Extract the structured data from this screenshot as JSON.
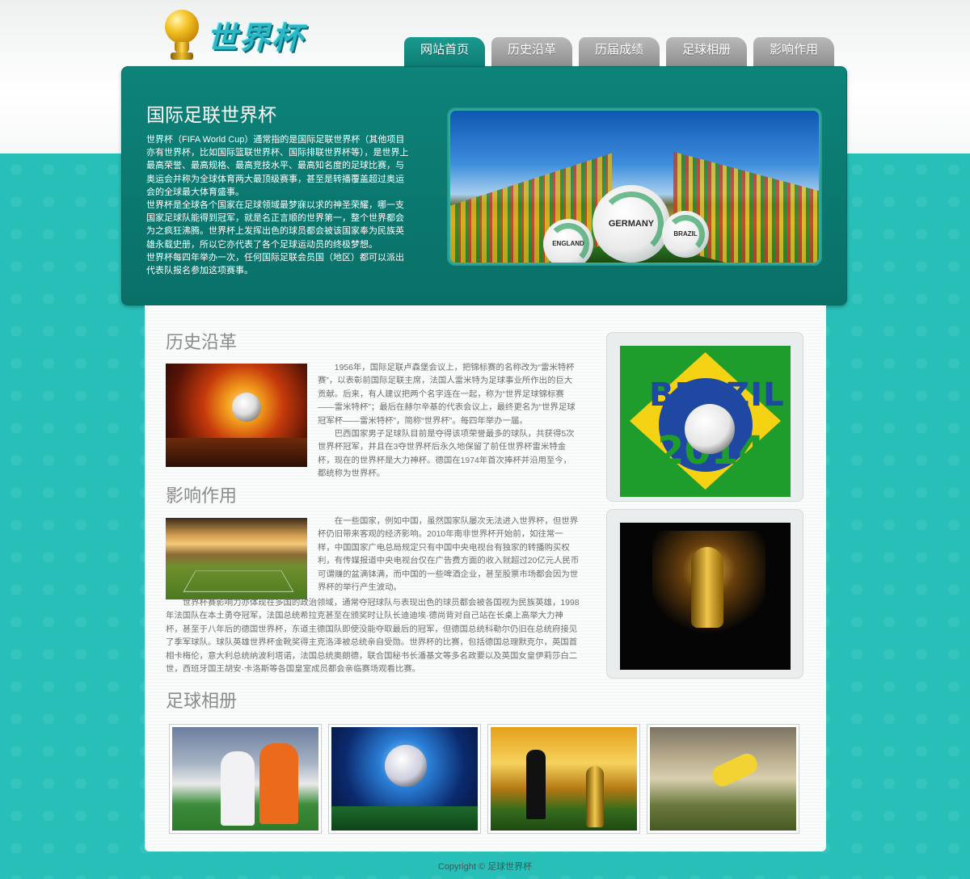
{
  "logo": {
    "text": "世界杯"
  },
  "nav": {
    "tabs": [
      {
        "label": "网站首页",
        "active": true
      },
      {
        "label": "历史沿革",
        "active": false
      },
      {
        "label": "历届成绩",
        "active": false
      },
      {
        "label": "足球相册",
        "active": false
      },
      {
        "label": "影响作用",
        "active": false
      }
    ]
  },
  "hero": {
    "title": "国际足联世界杯",
    "paragraphs": [
      "世界杯（FIFA World Cup）通常指的是国际足联世界杯（其他项目亦有世界杯，比如国际篮联世界杯、国际排联世界杯等），是世界上最高荣誉、最高规格、最高竞技水平、最高知名度的足球比赛，与奥运会并称为全球体育两大最顶级赛事，甚至是转播覆盖超过奥运会的全球最大体育盛事。",
      "世界杯是全球各个国家在足球领域最梦寐以求的神圣荣耀，哪一支国家足球队能得到冠军，就是名正言顺的世界第一，整个世界都会为之疯狂沸腾。世界杯上发挥出色的球员都会被该国家奉为民族英雄永载史册，所以它亦代表了各个足球运动员的终极梦想。",
      "世界杯每四年举办一次，任何国际足联会员国（地区）都可以派出代表队报名参加这项赛事。"
    ],
    "image_balls": [
      "GERMANY",
      "ENGLAND",
      "BRAZIL"
    ]
  },
  "history": {
    "title": "历史沿革",
    "paragraphs": [
      "1956年，国际足联卢森堡会议上，把锦标赛的名称改为“雷米特杯赛”，以表彰前国际足联主席，法国人雷米特为足球事业所作出的巨大贡献。后来，有人建议把两个名字连在一起，称为“世界足球锦标赛——雷米特杯”；最后在赫尔辛基的代表会议上，最终更名为“世界足球冠军杯——雷米特杯”，简称“世界杯”。每四年举办一届。",
      "巴西国家男子足球队目前是夺得该项荣誉最多的球队，共获得5次世界杯冠军，并且在3夺世界杯后永久地保留了前任世界杯雷米特金杯，现在的世界杯是大力神杯。德国在1974年首次捧杯并沿用至今，都统称为世界杯。"
    ]
  },
  "influence": {
    "title": "影响作用",
    "paragraphs": [
      "在一些国家，例如中国，虽然国家队屡次无法进入世界杯，但世界杯仍旧带来客观的经济影响。2010年南非世界杯开始前，如往常一样，中国国家广电总局规定只有中国中央电视台有独家的转播购买权利，有传媒报道中央电视台仅在广告费方面的收入就超过20亿元人民币可谓赚的盆满钵满，而中国的一些啤酒企业，甚至股票市场都会因为世界杯的举行产生波动。",
      "世界杯赛影响力亦体现在多国的政治领域，通常夺冠球队与表现出色的球员都会被各国视为民族英雄，1998年法国队在本土勇夺冠军，法国总统希拉克甚至在颁奖时让队长迪迪埃·德尚背对自己站在长桌上高举大力神杯，甚至于八年后的德国世界杯，东道主德国队即使没能夺取最后的冠军，但德国总统科勒尔仍旧在总统府接见了季军球队。球队英雄世界杯金靴奖得主克洛泽被总统亲自受勋。世界杯的比赛，包括德国总理默克尔，英国首相卡梅伦，意大利总统纳波利塔诺，法国总统奥朗德，联合国秘书长潘基文等多名政要以及英国女皇伊莉莎白二世，西班牙国王胡安·卡洛斯等各国皇室成员都会亲临赛场观看比赛。"
    ]
  },
  "sidebar": {
    "card1": {
      "line1": "BRAZIL",
      "line2": "2014"
    }
  },
  "gallery": {
    "title": "足球相册",
    "items": [
      "photo-1",
      "photo-2",
      "photo-3",
      "photo-4"
    ]
  },
  "footer": {
    "text": "Copyright © 足球世界杯"
  }
}
